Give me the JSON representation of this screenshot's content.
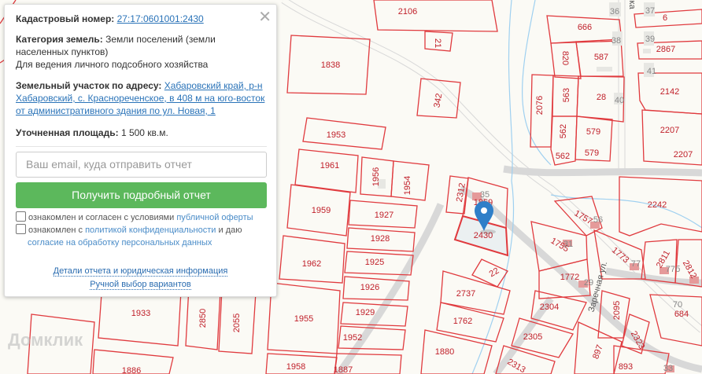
{
  "popup": {
    "cadastral_label": "Кадастровый номер:",
    "cadastral_value": "27:17:0601001:2430",
    "category_label": "Категория земель:",
    "category_value": "Земли поселений (земли населенных пунктов)",
    "use_value": "Для ведения личного подсобного хозяйства",
    "address_label": "Земельный участок по адресу:",
    "address_value": "Хабаровский край, р-н Хабаровский, с. Краснореченское, в 408 м на юго-восток от административного здания по ул. Новая, 1",
    "area_label": "Уточненная площадь:",
    "area_value": "1 500 кв.м.",
    "email_placeholder": "Ваш email, куда отправить отчет",
    "submit_label": "Получить подробный отчет",
    "consent1_text": "ознакомлен и согласен с условиями",
    "consent1_link": "публичной оферты",
    "consent2_text": "ознакомлен с",
    "consent2_link": "политикой конфиденциальности",
    "consent2_mid": "и даю",
    "consent2_link2": "согласие на обработку персональных данных",
    "details_link": "Детали отчета и юридическая информация",
    "manual_link": "Ручной выбор вариантов",
    "close_icon": "close-icon"
  },
  "map": {
    "watermark": "Домклик",
    "street": "Заречная ул.",
    "street_top": "ка",
    "selected_parcel": "2430",
    "parcels": [
      "2106",
      "21",
      "1838",
      "342",
      "1953",
      "1961",
      "1956",
      "1954",
      "1959",
      "1927",
      "1928",
      "1925",
      "1962",
      "1926",
      "1929",
      "1933",
      "1955",
      "2850",
      "2055",
      "1952",
      "1958",
      "1887",
      "1886",
      "2312",
      "1859",
      "22",
      "2737",
      "1762",
      "1880",
      "2304",
      "2305",
      "2313",
      "1757",
      "1755",
      "1773",
      "1772",
      "2095",
      "2323",
      "897",
      "893",
      "2811",
      "2812",
      "2242",
      "684",
      "666",
      "820",
      "587",
      "2076",
      "563",
      "28",
      "562",
      "562",
      "579",
      "579",
      "6",
      "2867",
      "2142",
      "2207",
      "2207"
    ],
    "houses": [
      "36",
      "37",
      "38",
      "39",
      "41",
      "40",
      "35",
      "56",
      "31",
      "77",
      "77б",
      "29",
      "70",
      "33"
    ]
  },
  "colors": {
    "parcel": "#e03a3e",
    "button": "#5cb85c",
    "link": "#2a73b8",
    "marker": "#2f7fc8"
  }
}
